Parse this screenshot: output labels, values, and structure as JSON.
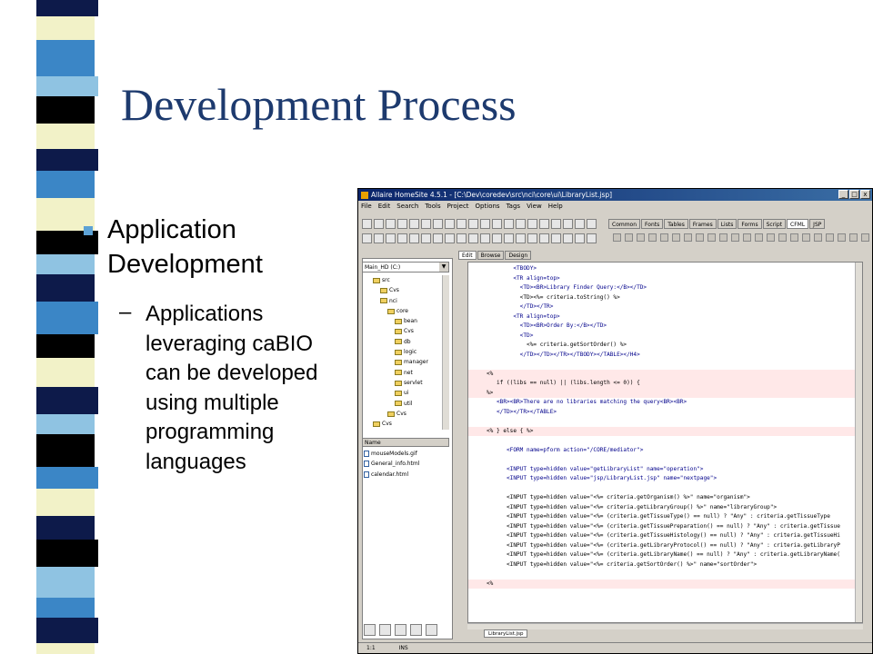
{
  "slide": {
    "title": "Development Process",
    "bullet": "Application Development",
    "dash": "–",
    "sub_bullet": "Applications leveraging caBIO can be developed using multiple programming languages",
    "accent_color": "#1d3a6e",
    "bullet_color": "#5da2d5"
  },
  "stripe_colors": [
    "#0d1a4a",
    "#f2f2c8",
    "#000000",
    "#3b86c6",
    "#8fc3e2"
  ],
  "window": {
    "title": "Allaire HomeSite 4.5.1 - [C:\\Dev\\coredev\\src\\nci\\core\\ui\\LibraryList.jsp]",
    "buttons": [
      "_",
      "□",
      "x"
    ],
    "menu": [
      "File",
      "Edit",
      "Search",
      "Tools",
      "Project",
      "Options",
      "Tags",
      "View",
      "Help"
    ],
    "tag_tabs": [
      "Common",
      "Fonts",
      "Tables",
      "Frames",
      "Lists",
      "Forms",
      "Script",
      "CFML",
      "JSP"
    ],
    "drive": "Main_HD (C:)",
    "tree": [
      {
        "label": "src",
        "indent": 1,
        "kind": "folder"
      },
      {
        "label": "Cvs",
        "indent": 2,
        "kind": "folder"
      },
      {
        "label": "nci",
        "indent": 2,
        "kind": "folder"
      },
      {
        "label": "core",
        "indent": 3,
        "kind": "folder"
      },
      {
        "label": "bean",
        "indent": 4,
        "kind": "folder"
      },
      {
        "label": "Cvs",
        "indent": 4,
        "kind": "folder"
      },
      {
        "label": "db",
        "indent": 4,
        "kind": "folder"
      },
      {
        "label": "logic",
        "indent": 4,
        "kind": "folder"
      },
      {
        "label": "manager",
        "indent": 4,
        "kind": "folder"
      },
      {
        "label": "net",
        "indent": 4,
        "kind": "folder"
      },
      {
        "label": "servlet",
        "indent": 4,
        "kind": "folder"
      },
      {
        "label": "ui",
        "indent": 4,
        "kind": "folder"
      },
      {
        "label": "util",
        "indent": 4,
        "kind": "folder"
      },
      {
        "label": "Cvs",
        "indent": 3,
        "kind": "folder"
      },
      {
        "label": "Cvs",
        "indent": 1,
        "kind": "folder"
      }
    ],
    "files_header": "Name",
    "files": [
      "mouseModels.gif",
      "General_info.html",
      "calendar.html"
    ],
    "editor_tabs": [
      "Edit",
      "Browse",
      "Design"
    ],
    "doc_tab": "LibraryList.jsp",
    "status": [
      "1:1",
      "INS"
    ],
    "code": [
      {
        "t": "        <TBODY>",
        "hl": false
      },
      {
        "t": "        <TR align=top>",
        "hl": false
      },
      {
        "t": "          <TD><BR>Library Finder Query:</B></TD>",
        "hl": false
      },
      {
        "t": "          <TD><%= criteria.toString() %>",
        "hl": false
      },
      {
        "t": "          </TD></TR>",
        "hl": false
      },
      {
        "t": "        <TR align=top>",
        "hl": false
      },
      {
        "t": "          <TD><BR>Order By:</B></TD>",
        "hl": false
      },
      {
        "t": "          <TD>",
        "hl": false
      },
      {
        "t": "            <%= criteria.getSortOrder() %>",
        "hl": false
      },
      {
        "t": "          </TD></TD></TR></TBODY></TABLE></H4>",
        "hl": false
      },
      {
        "t": "",
        "hl": false
      },
      {
        "t": "<%",
        "hl": true
      },
      {
        "t": "   if ((libs == null) || (libs.length <= 0)) {",
        "hl": true
      },
      {
        "t": "%>",
        "hl": true
      },
      {
        "t": "   <BR><BR>There are no libraries matching the query<BR><BR>",
        "hl": false
      },
      {
        "t": "   </TD></TR></TABLE>",
        "hl": false
      },
      {
        "t": "",
        "hl": false
      },
      {
        "t": "<% } else { %>",
        "hl": true
      },
      {
        "t": "",
        "hl": false
      },
      {
        "t": "      <FORM name=pform action=\"/CORE/mediator\">",
        "hl": false
      },
      {
        "t": "",
        "hl": false
      },
      {
        "t": "      <INPUT type=hidden value=\"getLibraryList\" name=\"operation\">",
        "hl": false
      },
      {
        "t": "      <INPUT type=hidden value=\"jsp/LibraryList.jsp\" name=\"nextpage\">",
        "hl": false
      },
      {
        "t": "",
        "hl": false
      },
      {
        "t": "      <INPUT type=hidden value=\"<%= criteria.getOrganism() %>\" name=\"organism\">",
        "hl": false
      },
      {
        "t": "      <INPUT type=hidden value=\"<%= criteria.getLibraryGroup() %>\" name=\"libraryGroup\">",
        "hl": false
      },
      {
        "t": "      <INPUT type=hidden value=\"<%= (criteria.getTissueType() == null) ? \"Any\" : criteria.getTissueType",
        "hl": false
      },
      {
        "t": "      <INPUT type=hidden value=\"<%= (criteria.getTissuePreparation() == null) ? \"Any\" : criteria.getTissue",
        "hl": false
      },
      {
        "t": "      <INPUT type=hidden value=\"<%= (criteria.getTissueHistology() == null) ? \"Any\" : criteria.getTissueHi",
        "hl": false
      },
      {
        "t": "      <INPUT type=hidden value=\"<%= (criteria.getLibraryProtocol() == null) ? \"Any\" : criteria.getLibraryP",
        "hl": false
      },
      {
        "t": "      <INPUT type=hidden value=\"<%= (criteria.getLibraryName() == null) ? \"Any\" : criteria.getLibraryName(",
        "hl": false
      },
      {
        "t": "      <INPUT type=hidden value=\"<%= criteria.getSortOrder() %>\" name=\"sortOrder\">",
        "hl": false
      },
      {
        "t": "",
        "hl": false
      },
      {
        "t": "<%",
        "hl": true
      }
    ]
  }
}
